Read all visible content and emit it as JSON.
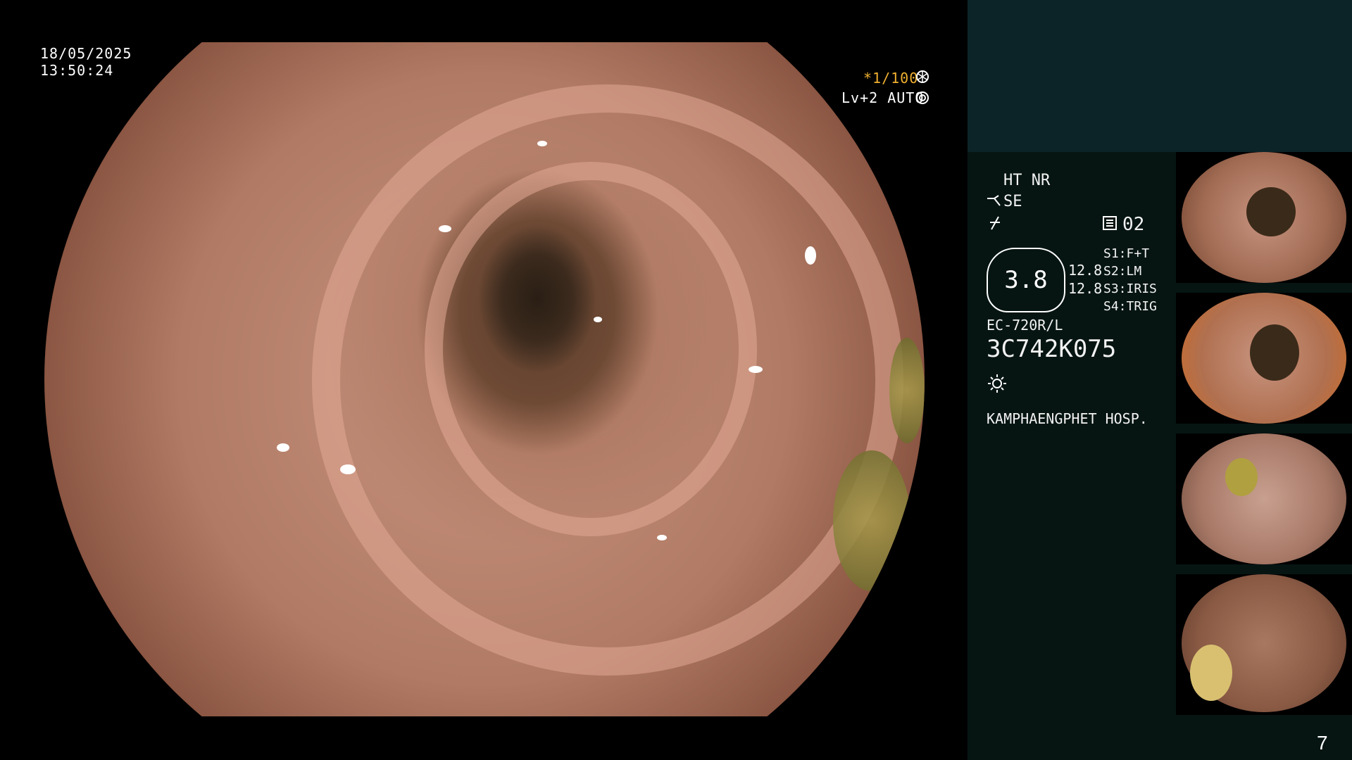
{
  "overlay": {
    "date": "18/05/2025",
    "time": "13:50:24",
    "shutter": "*1/100",
    "level": "Lv+2 AUTO"
  },
  "panel": {
    "mode_line": "HT NR",
    "se_label": "SE",
    "channel": "02",
    "dial_value": "3.8",
    "values": [
      "12.8",
      "12.8"
    ],
    "switches": [
      {
        "key": "S1:",
        "value": "F+T"
      },
      {
        "key": "S2:",
        "value": "LM"
      },
      {
        "key": "S3:",
        "value": "IRIS"
      },
      {
        "key": "S4:",
        "value": "TRIG"
      }
    ],
    "scope_model": "EC-720R/L",
    "serial": "3C742K075",
    "hospital": "KAMPHAENGPHET HOSP."
  },
  "page_number": "7",
  "colors": {
    "accent_orange": "#f0b030",
    "panel_dark": "#061512",
    "panel_top": "#0c2427"
  },
  "icons": [
    "aperture-icon",
    "iris-icon",
    "pliers-icon",
    "slash-icon",
    "memory-icon",
    "brightness-icon"
  ]
}
